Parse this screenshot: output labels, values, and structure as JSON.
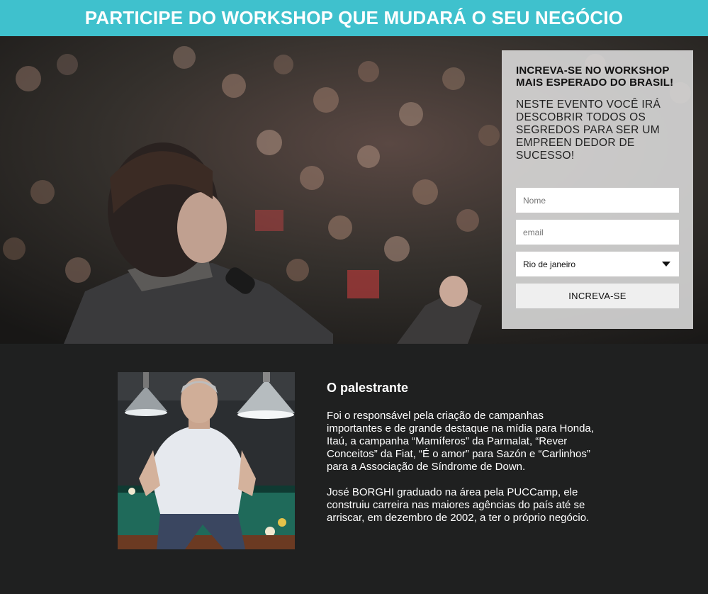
{
  "banner": {
    "title": "PARTICIPE DO WORKSHOP QUE MUDARÁ O SEU NEGÓCIO"
  },
  "hero": {
    "image": "speaker-on-stage-with-microphone-audience-photo"
  },
  "form": {
    "title": "INCREVA-SE NO WORKSHOP MAIS ESPERADO DO BRASIL!",
    "subtitle": "NESTE EVENTO VOCÊ IRÁ DESCOBRIR TODOS OS SEGREDOS PARA SER UM EMPREEN DEDOR DE SUCESSO!",
    "name_placeholder": "Nome",
    "email_placeholder": "email",
    "city_selected": "Rio de janeiro",
    "submit_label": "INCREVA-SE"
  },
  "speaker": {
    "photo": "speaker-portrait-photo",
    "heading": "O palestrante",
    "bio_1": "Foi o responsável pela criação de campanhas importantes e de grande destaque na mídia para Honda, Itaú, a campanha “Mamíferos” da Parmalat, “Rever Conceitos” da Fiat, “É o amor” para Sazón e “Carlinhos” para a Associação de Síndrome de Down.",
    "bio_2": "José BORGHI graduado na área pela PUCCamp, ele construiu carreira nas maiores agências do país até se arriscar, em dezembro de 2002, a ter o próprio negócio."
  },
  "colors": {
    "banner": "#3fc1cd",
    "page_bg": "#1f2020",
    "panel": "#e1e1e1"
  }
}
